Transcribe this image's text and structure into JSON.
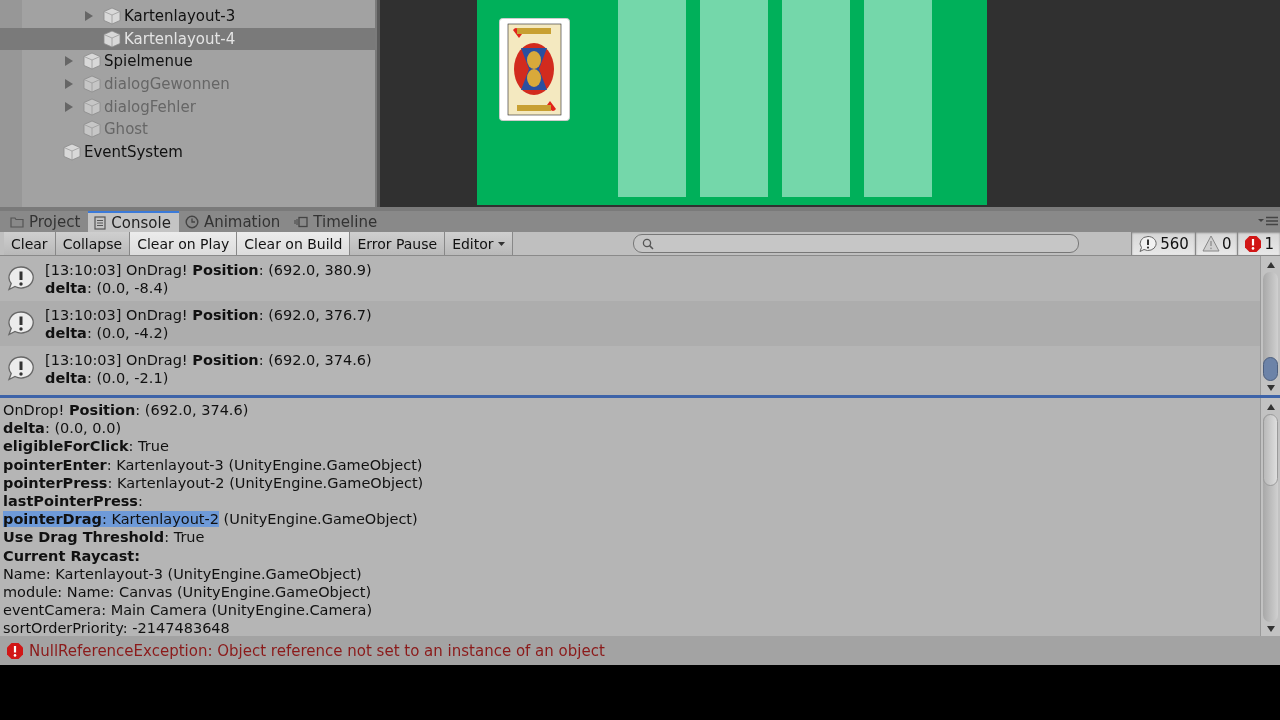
{
  "hierarchy": {
    "items": [
      {
        "children": [
          {
            "children": [
              {
                "label": "Kartenlayout-3",
                "expanded": false,
                "active": true,
                "selected": false
              },
              {
                "label": "Kartenlayout-4",
                "active": true,
                "selected": true
              }
            ]
          },
          {
            "label": "Spielmenue",
            "expanded": false,
            "active": true,
            "selected": false
          },
          {
            "label": "dialogGewonnen",
            "expanded": false,
            "active": false,
            "selected": false
          },
          {
            "label": "dialogFehler",
            "expanded": false,
            "active": false,
            "selected": false
          },
          {
            "label": "Ghost",
            "active": false,
            "selected": false
          }
        ]
      },
      {
        "label": "EventSystem",
        "active": true,
        "selected": false
      }
    ]
  },
  "tabs": [
    {
      "label": "Project",
      "kind": "project",
      "selected": false
    },
    {
      "label": "Console",
      "kind": "console",
      "selected": true
    },
    {
      "label": "Animation",
      "kind": "animation",
      "selected": false
    },
    {
      "label": "Timeline",
      "kind": "timeline",
      "selected": false
    }
  ],
  "toolbar": {
    "buttons": [
      {
        "label": "Clear",
        "kind": "button"
      },
      {
        "label": "Collapse",
        "kind": "toggle",
        "on": false
      },
      {
        "label": "Clear on Play",
        "kind": "toggle",
        "on": true
      },
      {
        "label": "Clear on Build",
        "kind": "toggle",
        "on": true
      },
      {
        "label": "Error Pause",
        "kind": "toggle",
        "on": false
      },
      {
        "label": "Editor",
        "kind": "dropdown"
      }
    ],
    "counters": [
      {
        "kind": "info",
        "count": "560"
      },
      {
        "kind": "warning",
        "count": "0"
      },
      {
        "kind": "error",
        "count": "1"
      }
    ]
  },
  "log": [
    {
      "line1": "[13:10:03] OnDrag! **Position**: (692.0, 380.9)",
      "line2": "**delta**: (0.0, -8.4)",
      "selected": false
    },
    {
      "line1": "[13:10:03] OnDrag! **Position**: (692.0, 376.7)",
      "line2": "**delta**: (0.0, -4.2)",
      "selected": false
    },
    {
      "line1": "[13:10:03] OnDrag! **Position**: (692.0, 374.6)",
      "line2": "**delta**: (0.0, -2.1)",
      "selected": false
    }
  ],
  "details": [
    {
      "text": "OnDrop! **Position**: (692.0, 374.6)"
    },
    {
      "text": "**delta**: (0.0, 0.0)"
    },
    {
      "text": "**eligibleForClick**: True"
    },
    {
      "text": "**pointerEnter**: Kartenlayout-3 (UnityEngine.GameObject)"
    },
    {
      "text": "**pointerPress**: Kartenlayout-2 (UnityEngine.GameObject)"
    },
    {
      "text": "**lastPointerPress**:"
    },
    {
      "highlight": "**pointerDrag**: Kartenlayout-2",
      "text": " (UnityEngine.GameObject)"
    },
    {
      "text": "**Use Drag Threshold**: True"
    },
    {
      "text": "**Current Raycast:**"
    },
    {
      "text": "Name: Kartenlayout-3 (UnityEngine.GameObject)"
    },
    {
      "text": "module: Name: Canvas (UnityEngine.GameObject)"
    },
    {
      "text": "eventCamera: Main Camera (UnityEngine.Camera)"
    },
    {
      "text": "sortOrderPriority: -2147483648"
    }
  ],
  "status_bar": {
    "kind": "error",
    "message": "NullReferenceException: Object reference not set to an instance of an object"
  }
}
